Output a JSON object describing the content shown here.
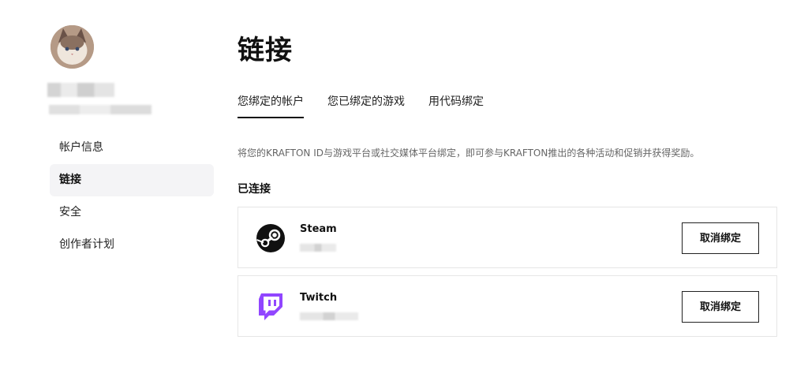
{
  "sidebar": {
    "items": [
      {
        "label": "帐户信息"
      },
      {
        "label": "链接"
      },
      {
        "label": "安全"
      },
      {
        "label": "创作者计划"
      }
    ]
  },
  "main": {
    "title": "链接",
    "tabs": [
      {
        "label": "您绑定的帐户"
      },
      {
        "label": "您已绑定的游戏"
      },
      {
        "label": "用代码绑定"
      }
    ],
    "description": "将您的KRAFTON ID与游戏平台或社交媒体平台绑定，即可参与KRAFTON推出的各种活动和促销并获得奖励。",
    "connected_title": "已连接",
    "accounts": [
      {
        "name": "Steam",
        "button": "取消绑定",
        "icon": "steam-icon"
      },
      {
        "name": "Twitch",
        "button": "取消绑定",
        "icon": "twitch-icon"
      }
    ]
  },
  "colors": {
    "twitch": "#9146ff",
    "active_nav_bg": "#f4f4f6",
    "text": "#111111"
  }
}
